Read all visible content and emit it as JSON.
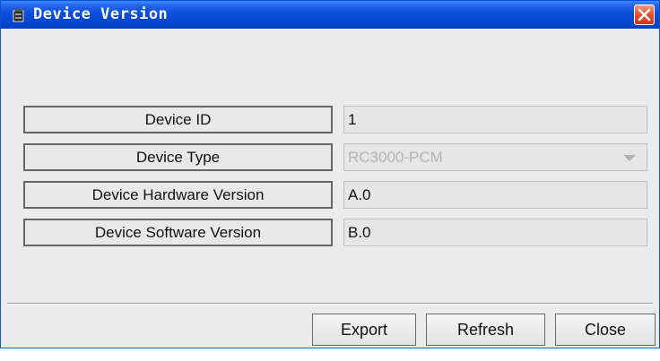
{
  "window": {
    "title": "Device Version",
    "title_icon": "device-icon",
    "close_icon": "close-icon",
    "accent_color": "#0a4ed8",
    "close_color": "#e4532e"
  },
  "fields": [
    {
      "label": "Device ID",
      "value": "1",
      "type": "text"
    },
    {
      "label": "Device Type",
      "value": "RC3000-PCM",
      "type": "select"
    },
    {
      "label": "Device Hardware Version",
      "value": "A.0",
      "type": "text"
    },
    {
      "label": "Device Software Version",
      "value": "B.0",
      "type": "text"
    }
  ],
  "buttons": {
    "export_label": "Export",
    "refresh_label": "Refresh",
    "close_label": "Close"
  }
}
